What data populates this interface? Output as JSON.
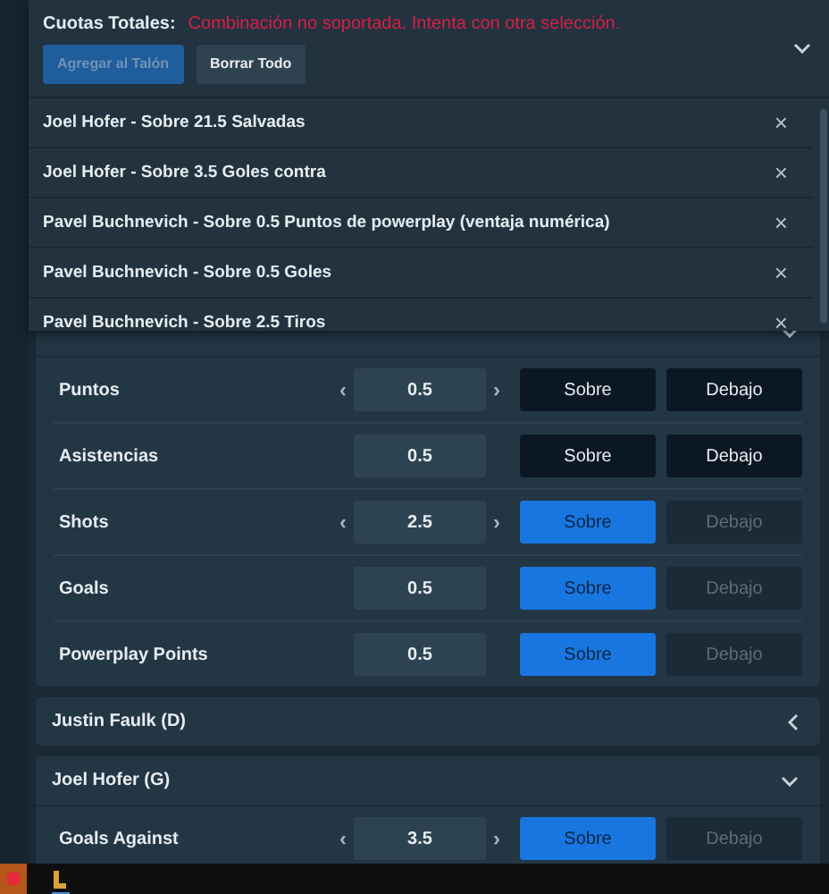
{
  "betslip": {
    "title": "Cuotas Totales:",
    "error": "Combinación no soportada. Intenta con otra selección.",
    "expanded": true,
    "buttons": [
      {
        "label": "Agregar al Talón",
        "kind": "primary",
        "disabled": true
      },
      {
        "label": "Borrar Todo",
        "kind": "secondary",
        "disabled": false
      }
    ],
    "selections": [
      {
        "text": "Joel Hofer - Sobre 21.5 Salvadas",
        "remove": "×"
      },
      {
        "text": "Joel Hofer - Sobre 3.5 Goles contra",
        "remove": "×"
      },
      {
        "text": "Pavel Buchnevich - Sobre 0.5 Puntos de powerplay (ventaja numérica)",
        "remove": "×"
      },
      {
        "text": "Pavel Buchnevich - Sobre 0.5 Goles",
        "remove": "×"
      },
      {
        "text": "Pavel Buchnevich - Sobre 2.5 Tiros",
        "remove": "×"
      }
    ]
  },
  "groups": [
    {
      "expanded": true,
      "rows": [
        {
          "label": "Puntos",
          "dec": "‹",
          "inc": "›",
          "value": "0.5",
          "options": [
            {
              "label": "Sobre",
              "selected": false,
              "disabled": false
            },
            {
              "label": "Debajo",
              "selected": false,
              "disabled": false
            }
          ]
        },
        {
          "label": "Asistencias",
          "value": "0.5",
          "options": [
            {
              "label": "Sobre",
              "selected": false,
              "disabled": false
            },
            {
              "label": "Debajo",
              "selected": false,
              "disabled": false
            }
          ]
        },
        {
          "label": "Shots",
          "dec": "‹",
          "inc": "›",
          "value": "2.5",
          "options": [
            {
              "label": "Sobre",
              "selected": true,
              "disabled": false
            },
            {
              "label": "Debajo",
              "selected": false,
              "disabled": true
            }
          ]
        },
        {
          "label": "Goals",
          "value": "0.5",
          "options": [
            {
              "label": "Sobre",
              "selected": true,
              "disabled": false
            },
            {
              "label": "Debajo",
              "selected": false,
              "disabled": true
            }
          ]
        },
        {
          "label": "Powerplay Points",
          "value": "0.5",
          "options": [
            {
              "label": "Sobre",
              "selected": true,
              "disabled": false
            },
            {
              "label": "Debajo",
              "selected": false,
              "disabled": true
            }
          ]
        }
      ]
    },
    {
      "title": "Justin Faulk (D)",
      "expanded": false
    },
    {
      "title": "Joel Hofer (G)",
      "expanded": true,
      "rows": [
        {
          "label": "Goals Against",
          "dec": "‹",
          "inc": "›",
          "value": "3.5",
          "options": [
            {
              "label": "Sobre",
              "selected": true,
              "disabled": false
            },
            {
              "label": "Debajo",
              "selected": false,
              "disabled": true
            }
          ]
        }
      ]
    }
  ]
}
